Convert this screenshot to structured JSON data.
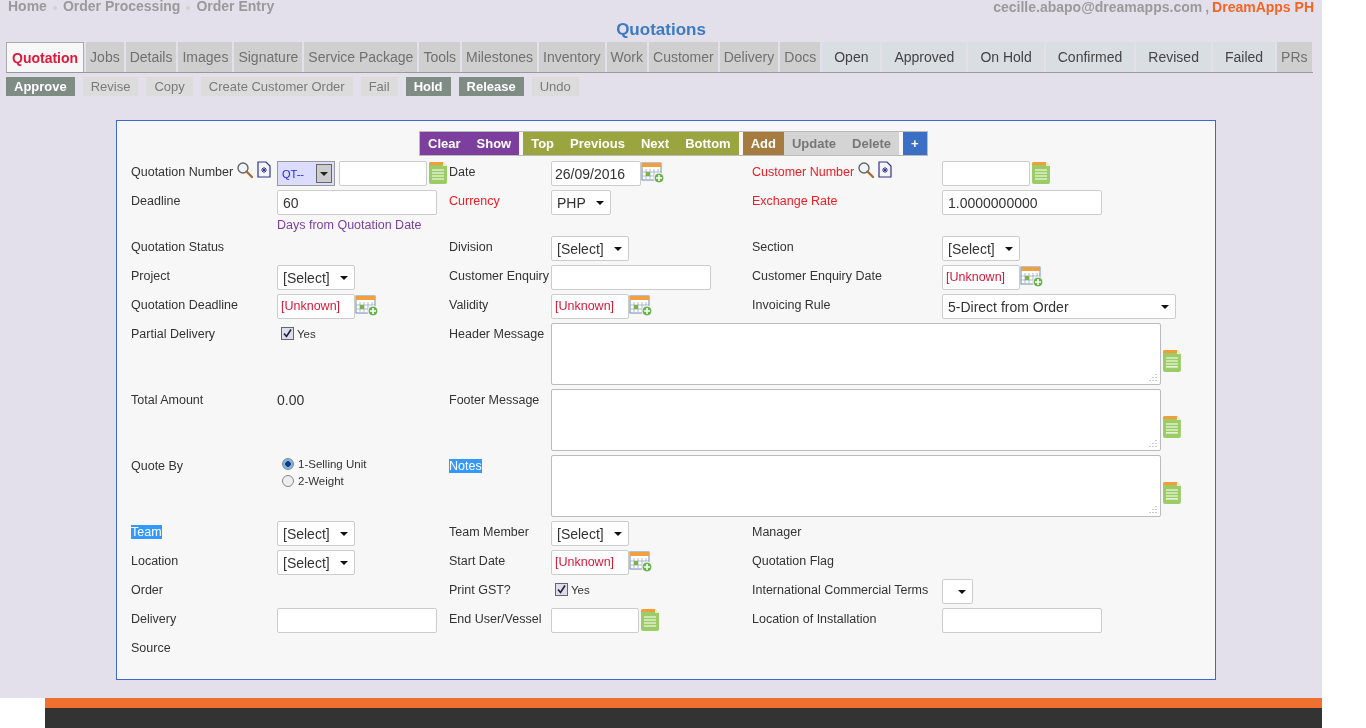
{
  "breadcrumbs": [
    "Home",
    "Order Processing",
    "Order Entry"
  ],
  "user": {
    "email": "cecille.abapo@dreamapps.com",
    "separator": ",",
    "company": "DreamApps PH"
  },
  "title": "Quotations",
  "tabs": [
    {
      "label": "Quotation",
      "selected": true,
      "disabled": false
    },
    {
      "label": "Jobs",
      "selected": false,
      "disabled": true
    },
    {
      "label": "Details",
      "selected": false,
      "disabled": true
    },
    {
      "label": "Images",
      "selected": false,
      "disabled": true
    },
    {
      "label": "Signature",
      "selected": false,
      "disabled": true
    },
    {
      "label": "Service Package",
      "selected": false,
      "disabled": true
    },
    {
      "label": "Tools",
      "selected": false,
      "disabled": true
    },
    {
      "label": "Milestones",
      "selected": false,
      "disabled": true
    },
    {
      "label": "Inventory",
      "selected": false,
      "disabled": true
    },
    {
      "label": "Work",
      "selected": false,
      "disabled": true
    },
    {
      "label": "Customer",
      "selected": false,
      "disabled": true
    },
    {
      "label": "Delivery",
      "selected": false,
      "disabled": true
    },
    {
      "label": "Docs",
      "selected": false,
      "disabled": true
    },
    {
      "label": "Open",
      "selected": false,
      "disabled": false
    },
    {
      "label": "Approved",
      "selected": false,
      "disabled": false
    },
    {
      "label": "On Hold",
      "selected": false,
      "disabled": false
    },
    {
      "label": "Confirmed",
      "selected": false,
      "disabled": false
    },
    {
      "label": "Revised",
      "selected": false,
      "disabled": false
    },
    {
      "label": "Failed",
      "selected": false,
      "disabled": false
    },
    {
      "label": "PRs",
      "selected": false,
      "disabled": true
    }
  ],
  "actions": [
    {
      "label": "Approve",
      "disabled": false
    },
    {
      "label": "Revise",
      "disabled": true
    },
    {
      "label": "Copy",
      "disabled": true
    },
    {
      "label": "Create Customer Order",
      "disabled": true
    },
    {
      "label": "Fail",
      "disabled": true
    },
    {
      "label": "Hold",
      "disabled": false
    },
    {
      "label": "Release",
      "disabled": false
    },
    {
      "label": "Undo",
      "disabled": true
    }
  ],
  "toolbar": [
    {
      "color": "#7d3f9e",
      "buttons": [
        {
          "label": "Clear",
          "disabled": false
        },
        {
          "label": "Show",
          "disabled": false
        }
      ]
    },
    {
      "color": "#9aa53f",
      "buttons": [
        {
          "label": "Top",
          "disabled": false
        },
        {
          "label": "Previous",
          "disabled": false
        },
        {
          "label": "Next",
          "disabled": false
        },
        {
          "label": "Bottom",
          "disabled": false
        }
      ]
    },
    {
      "color": "#a57b3f",
      "buttons": [
        {
          "label": "Add",
          "disabled": false
        },
        {
          "label": "Update",
          "disabled": true
        },
        {
          "label": "Delete",
          "disabled": true
        }
      ]
    },
    {
      "color": "#3b6fc4",
      "buttons": [
        {
          "label": "+",
          "disabled": false
        }
      ]
    }
  ],
  "form": [
    {
      "fields": [
        {
          "label": "Quotation Number",
          "required": false,
          "highlighted": false,
          "lookup": true,
          "control": {
            "kind": "prefixed",
            "prefix": "QT--",
            "note": true
          }
        },
        {
          "label": "Date",
          "required": false,
          "highlighted": false,
          "control": {
            "kind": "date",
            "value": "26/09/2016",
            "unset": false
          }
        },
        {
          "label": "Customer Number",
          "required": true,
          "highlighted": false,
          "lookup": true,
          "control": {
            "kind": "text",
            "note": true
          }
        }
      ]
    },
    {
      "fields": [
        {
          "label": "Deadline",
          "required": false,
          "highlighted": false,
          "control": {
            "kind": "text",
            "value": "60",
            "hint": "Days from Quotation Date"
          }
        },
        {
          "label": "Currency",
          "required": true,
          "highlighted": false,
          "control": {
            "kind": "select",
            "value": "PHP"
          }
        },
        {
          "label": "Exchange Rate",
          "required": true,
          "highlighted": false,
          "control": {
            "kind": "text",
            "value": "1.0000000000"
          }
        }
      ]
    },
    {
      "fields": [
        {
          "label": "Quotation Status",
          "required": false,
          "highlighted": false,
          "control": {
            "kind": "none"
          }
        },
        {
          "label": "Division",
          "required": false,
          "highlighted": false,
          "control": {
            "kind": "select",
            "value": "[Select]"
          }
        },
        {
          "label": "Section",
          "required": false,
          "highlighted": false,
          "control": {
            "kind": "select",
            "value": "[Select]"
          }
        }
      ]
    },
    {
      "fields": [
        {
          "label": "Project",
          "required": false,
          "highlighted": false,
          "control": {
            "kind": "select",
            "value": "[Select]"
          }
        },
        {
          "label": "Customer Enquiry",
          "required": false,
          "highlighted": false,
          "control": {
            "kind": "text"
          }
        },
        {
          "label": "Customer Enquiry Date",
          "required": false,
          "highlighted": false,
          "control": {
            "kind": "date",
            "value": "[Unknown]",
            "unset": true
          }
        }
      ]
    },
    {
      "fields": [
        {
          "label": "Quotation Deadline",
          "required": false,
          "highlighted": false,
          "control": {
            "kind": "date",
            "value": "[Unknown]",
            "unset": true
          }
        },
        {
          "label": "Validity",
          "required": false,
          "highlighted": false,
          "control": {
            "kind": "date",
            "value": "[Unknown]",
            "unset": true
          }
        },
        {
          "label": "Invoicing Rule",
          "required": false,
          "highlighted": false,
          "control": {
            "kind": "select",
            "value": "5-Direct from Order"
          }
        }
      ]
    },
    {
      "fields": [
        {
          "label": "Partial Delivery",
          "required": false,
          "highlighted": false,
          "control": {
            "kind": "checkbox",
            "checked": true,
            "text": "Yes"
          }
        },
        {
          "label": "Header Message",
          "required": false,
          "highlighted": false,
          "control": {
            "kind": "textarea",
            "note": true
          }
        }
      ]
    },
    {
      "fields": [
        {
          "label": "Total Amount",
          "required": false,
          "highlighted": false,
          "control": {
            "kind": "value",
            "value": "0.00"
          }
        },
        {
          "label": "Footer Message",
          "required": false,
          "highlighted": false,
          "control": {
            "kind": "textarea",
            "note": true
          }
        }
      ]
    },
    {
      "fields": [
        {
          "label": "Quote By",
          "required": false,
          "highlighted": false,
          "control": {
            "kind": "radio",
            "options": [
              {
                "label": "1-Selling Unit",
                "selected": true
              },
              {
                "label": "2-Weight",
                "selected": false
              }
            ]
          }
        },
        {
          "label": "Notes",
          "required": false,
          "highlighted": true,
          "control": {
            "kind": "textarea",
            "note": true
          }
        }
      ]
    },
    {
      "fields": [
        {
          "label": "Team",
          "required": false,
          "highlighted": true,
          "control": {
            "kind": "select",
            "value": "[Select]"
          }
        },
        {
          "label": "Team Member",
          "required": false,
          "highlighted": false,
          "control": {
            "kind": "select",
            "value": "[Select]"
          }
        },
        {
          "label": "Manager",
          "required": false,
          "highlighted": false,
          "control": {
            "kind": "none"
          }
        }
      ]
    },
    {
      "fields": [
        {
          "label": "Location",
          "required": false,
          "highlighted": false,
          "control": {
            "kind": "select",
            "value": "[Select]"
          }
        },
        {
          "label": "Start Date",
          "required": false,
          "highlighted": false,
          "control": {
            "kind": "date",
            "value": "[Unknown]",
            "unset": true
          }
        },
        {
          "label": "Quotation Flag",
          "required": false,
          "highlighted": false,
          "control": {
            "kind": "none"
          }
        }
      ]
    },
    {
      "fields": [
        {
          "label": "Order",
          "required": false,
          "highlighted": false,
          "control": {
            "kind": "none"
          }
        },
        {
          "label": "Print GST?",
          "required": false,
          "highlighted": false,
          "control": {
            "kind": "checkbox",
            "checked": true,
            "text": "Yes"
          }
        },
        {
          "label": "International Commercial Terms",
          "required": false,
          "highlighted": false,
          "control": {
            "kind": "select"
          }
        }
      ]
    },
    {
      "fields": [
        {
          "label": "Delivery",
          "required": false,
          "highlighted": false,
          "control": {
            "kind": "text"
          }
        },
        {
          "label": "End User/Vessel",
          "required": false,
          "highlighted": false,
          "control": {
            "kind": "text",
            "note": true
          }
        },
        {
          "label": "Location of Installation",
          "required": false,
          "highlighted": false,
          "control": {
            "kind": "text"
          }
        }
      ]
    },
    {
      "fields": [
        {
          "label": "Source",
          "required": false,
          "highlighted": false,
          "control": {
            "kind": "none"
          }
        }
      ]
    }
  ]
}
